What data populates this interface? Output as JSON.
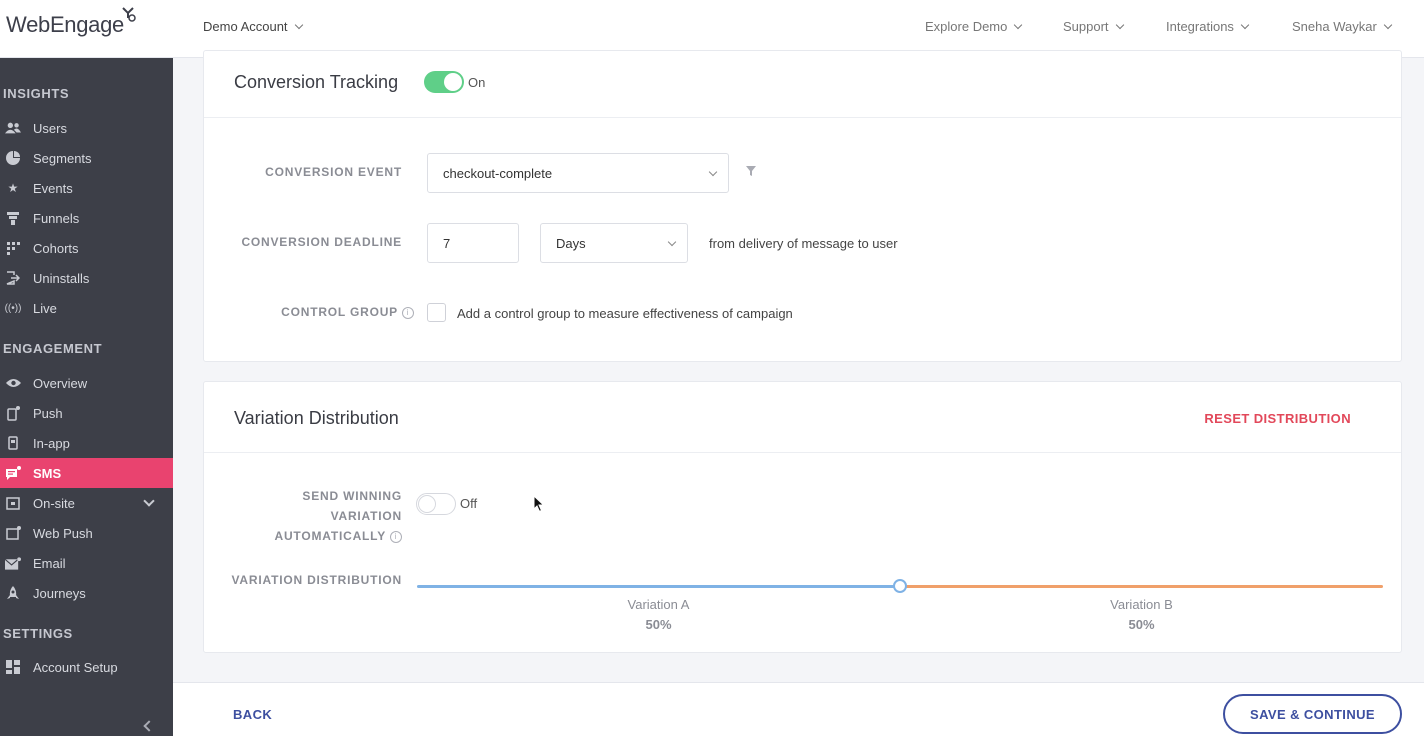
{
  "header": {
    "logo": "WebEngage",
    "account": "Demo Account",
    "nav": [
      "Explore Demo",
      "Support",
      "Integrations",
      "Sneha Waykar"
    ]
  },
  "sidebar": {
    "sections": {
      "insights": "INSIGHTS",
      "engagement": "ENGAGEMENT",
      "settings": "SETTINGS"
    },
    "insights_items": [
      {
        "label": "Users",
        "icon": "users-icon"
      },
      {
        "label": "Segments",
        "icon": "pie-icon"
      },
      {
        "label": "Events",
        "icon": "star-icon"
      },
      {
        "label": "Funnels",
        "icon": "funnel-icon"
      },
      {
        "label": "Cohorts",
        "icon": "grid-icon"
      },
      {
        "label": "Uninstalls",
        "icon": "exit-icon"
      },
      {
        "label": "Live",
        "icon": "broadcast-icon"
      }
    ],
    "engagement_items": [
      {
        "label": "Overview",
        "icon": "eye-icon"
      },
      {
        "label": "Push",
        "icon": "mobile-icon"
      },
      {
        "label": "In-app",
        "icon": "tablet-icon"
      },
      {
        "label": "SMS",
        "icon": "sms-icon",
        "active": true
      },
      {
        "label": "On-site",
        "icon": "window-icon"
      },
      {
        "label": "Web Push",
        "icon": "browser-icon"
      },
      {
        "label": "Email",
        "icon": "mail-icon"
      },
      {
        "label": "Journeys",
        "icon": "rocket-icon"
      }
    ],
    "settings_items": [
      {
        "label": "Account Setup",
        "icon": "dashboard-icon"
      }
    ]
  },
  "conversion": {
    "title": "Conversion Tracking",
    "toggle_label": "On",
    "event_label": "CONVERSION EVENT",
    "event_value": "checkout-complete",
    "deadline_label": "CONVERSION DEADLINE",
    "deadline_value": "7",
    "deadline_unit": "Days",
    "deadline_suffix": "from delivery of message to user",
    "control_label": "CONTROL GROUP",
    "control_text": "Add a control group to measure effectiveness of campaign"
  },
  "variation": {
    "title": "Variation Distribution",
    "reset": "RESET DISTRIBUTION",
    "winning_label_1": "SEND WINNING",
    "winning_label_2": "VARIATION",
    "winning_label_3": "AUTOMATICALLY",
    "winning_toggle": "Off",
    "dist_label": "VARIATION DISTRIBUTION",
    "split": 0.5,
    "a_name": "Variation A",
    "a_pct": "50%",
    "b_name": "Variation B",
    "b_pct": "50%"
  },
  "footer": {
    "back": "BACK",
    "save": "SAVE & CONTINUE"
  },
  "colors": {
    "accent_pink": "#e9436f",
    "toggle_on": "#5fcf88",
    "primary_blue": "#3d4fa0",
    "variation_a": "#7fb2e5",
    "variation_b": "#f0a06a",
    "reset_red": "#e2485a"
  }
}
